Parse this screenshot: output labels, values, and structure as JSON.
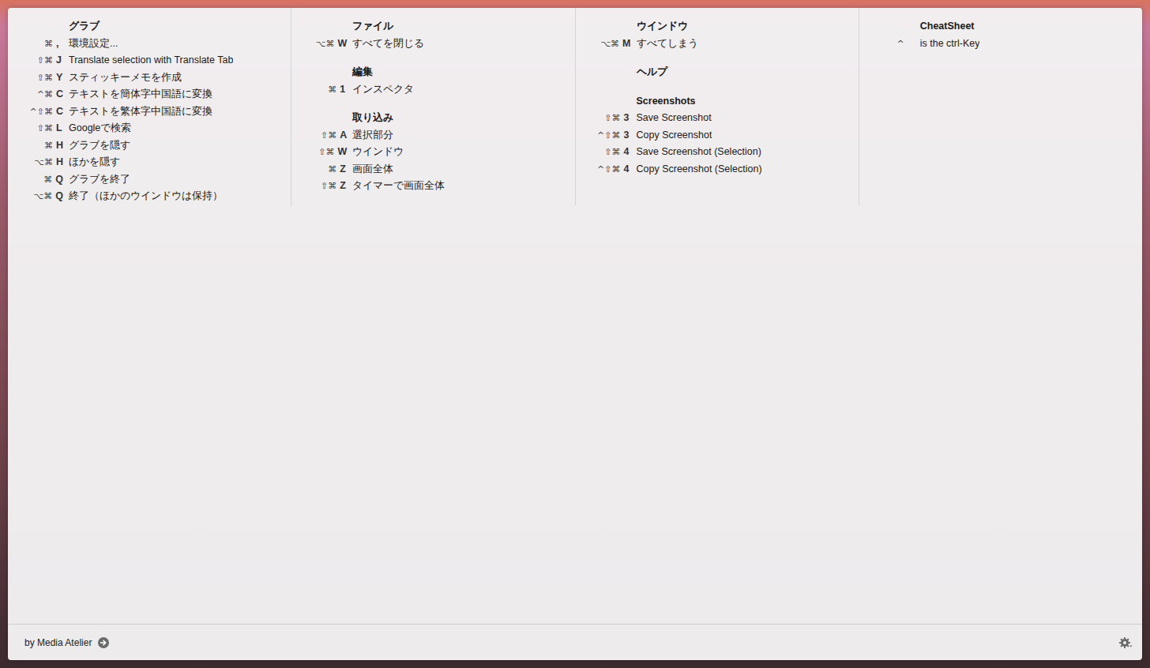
{
  "columns": [
    {
      "sections": [
        {
          "title": "グラブ",
          "items": [
            {
              "mods": "⌘",
              "key": ",",
              "label": "環境設定..."
            },
            {
              "mods": "⇧⌘",
              "key": "J",
              "label": "Translate selection with Translate Tab"
            },
            {
              "mods": "⇧⌘",
              "key": "Y",
              "label": "スティッキーメモを作成"
            },
            {
              "mods": "^⌘",
              "key": "C",
              "label": "テキストを簡体字中国語に変換"
            },
            {
              "mods": "^⇧⌘",
              "key": "C",
              "label": "テキストを繁体字中国語に変換"
            },
            {
              "mods": "⇧⌘",
              "key": "L",
              "label": "Googleで検索"
            },
            {
              "mods": "⌘",
              "key": "H",
              "label": "グラブを隠す"
            },
            {
              "mods": "⌥⌘",
              "key": "H",
              "label": "ほかを隠す"
            },
            {
              "mods": "⌘",
              "key": "Q",
              "label": "グラブを終了"
            },
            {
              "mods": "⌥⌘",
              "key": "Q",
              "label": "終了（ほかのウインドウは保持）"
            }
          ]
        }
      ]
    },
    {
      "sections": [
        {
          "title": "ファイル",
          "items": [
            {
              "mods": "⌥⌘",
              "key": "W",
              "label": "すべてを閉じる"
            }
          ]
        },
        {
          "title": "編集",
          "items": [
            {
              "mods": "⌘",
              "key": "1",
              "label": "インスペクタ"
            }
          ]
        },
        {
          "title": "取り込み",
          "items": [
            {
              "mods": "⇧⌘",
              "key": "A",
              "label": "選択部分"
            },
            {
              "mods": "⇧⌘",
              "key": "W",
              "label": "ウインドウ"
            },
            {
              "mods": "⌘",
              "key": "Z",
              "label": "画面全体"
            },
            {
              "mods": "⇧⌘",
              "key": "Z",
              "label": "タイマーで画面全体"
            }
          ]
        }
      ]
    },
    {
      "sections": [
        {
          "title": "ウインドウ",
          "items": [
            {
              "mods": "⌥⌘",
              "key": "M",
              "label": "すべてしまう"
            }
          ]
        },
        {
          "title": "ヘルプ",
          "items": []
        },
        {
          "title": "Screenshots",
          "items": [
            {
              "mods": "⇧⌘",
              "key": "3",
              "label": "Save Screenshot"
            },
            {
              "mods": "^⇧⌘",
              "key": "3",
              "label": "Copy Screenshot"
            },
            {
              "mods": "⇧⌘",
              "key": "4",
              "label": "Save Screenshot (Selection)"
            },
            {
              "mods": "^⇧⌘",
              "key": "4",
              "label": "Copy Screenshot (Selection)"
            }
          ]
        }
      ]
    },
    {
      "sections": [
        {
          "title": "CheatSheet",
          "items": [
            {
              "mods": "^",
              "label": "is the ctrl-Key"
            }
          ]
        }
      ]
    }
  ],
  "footer": {
    "credit": "by Media Atelier"
  }
}
